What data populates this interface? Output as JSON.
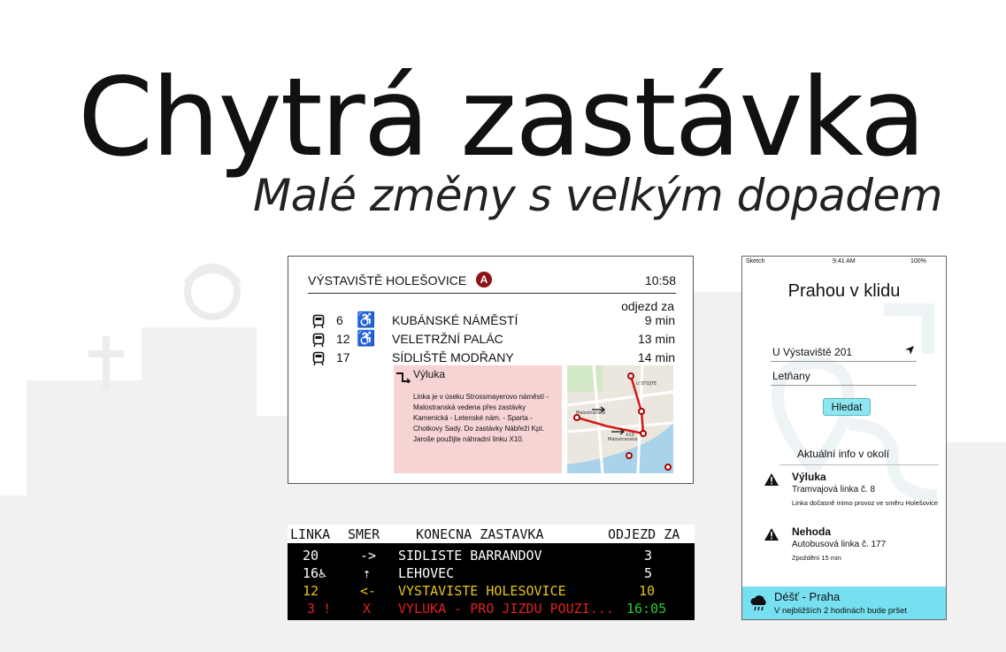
{
  "header": {
    "title": "Chytrá zastávka",
    "subtitle": "Malé změny s velkým dopadem"
  },
  "stop_display": {
    "stop_name": "VÝSTAVIŠTĚ HOLEŠOVICE",
    "zone_badge": "A",
    "clock": "10:58",
    "column_label": "odjezd za",
    "departures": [
      {
        "line": "6",
        "destination": "KUBÁNSKÉ NÁMĚSTÍ",
        "time": "9 min",
        "wheelchair_color": "#111111"
      },
      {
        "line": "12",
        "destination": "VELETRŽNÍ PALÁC",
        "time": "13 min",
        "wheelchair_color": "#e02020"
      },
      {
        "line": "17",
        "destination": "SÍDLIŠTĚ MODŘANY",
        "time": "14 min",
        "wheelchair_color": null
      }
    ],
    "alert": {
      "title": "Výluka",
      "text": "Linka je v úseku Strossmayerovo náměstí - Malostranská vedena přes zastávky Kamenická - Letenské nám. - Sparta - Chotkovy Sady. Do zastávky Nábřeží Kpt. Jaroše použijte náhradní linku X10."
    },
    "map": {
      "labels": [
        "Malostranská",
        "Malostranská",
        "X10",
        "U STOJTE"
      ]
    },
    "icons": {
      "tram": "tram-icon",
      "wheelchair": "wheelchair-icon",
      "detour": "detour-icon"
    },
    "badge_color": "#8b1515"
  },
  "led_board": {
    "headers": {
      "line": "LINKA",
      "direction": "SMER",
      "destination": "KONECNA ZASTAVKA",
      "departure": "ODJEZD ZA"
    },
    "rows": [
      {
        "line": "20",
        "direction": "->",
        "destination": "SIDLISTE BARRANDOV",
        "time": "3",
        "color": "#ffffff",
        "time_color": "#ffffff"
      },
      {
        "line": "16♿",
        "direction": "⇡",
        "destination": "LEHOVEC",
        "time": "5",
        "color": "#ffffff",
        "time_color": "#ffffff"
      },
      {
        "line": "12",
        "direction": "<-",
        "destination": "VYSTAVISTE HOLESOVICE",
        "time": "10",
        "color": "#e8c41a",
        "time_color": "#e8c41a"
      },
      {
        "line": "3 !",
        "direction": "X",
        "destination": "VYLUKA - PRO JIZDU POUZI...",
        "time": "16:05",
        "color": "#e02020",
        "time_color": "#22cc33"
      }
    ]
  },
  "phone": {
    "status": {
      "carrier": "Sketch",
      "time": "9:41 AM",
      "battery": "100%"
    },
    "app_title": "Prahou v klidu",
    "from_value": "U Výstaviště 201",
    "to_value": "Letňany",
    "search_button": "Hledat",
    "info_heading": "Aktuální info v okolí",
    "items": [
      {
        "title": "Výluka",
        "line": "Tramvajová linka č. 8",
        "desc": "Linka dočasně mimo provoz ve směru Holešovice"
      },
      {
        "title": "Nehoda",
        "line": "Autobusová linka č. 177",
        "desc": "Zpoždění 15 min"
      }
    ],
    "weather": {
      "title": "Déšť - Praha",
      "text": "V nejbližších 2 hodinách bude pršet"
    },
    "accent_color": "#77e0f0"
  }
}
